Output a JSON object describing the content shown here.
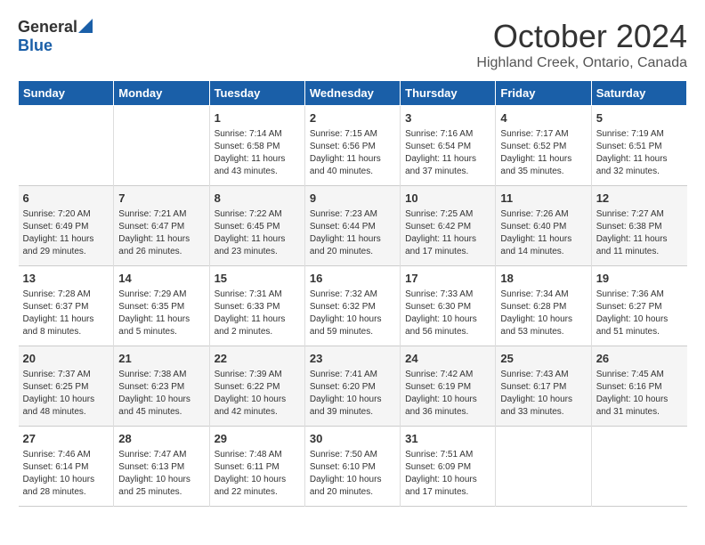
{
  "header": {
    "logo_general": "General",
    "logo_blue": "Blue",
    "month": "October 2024",
    "location": "Highland Creek, Ontario, Canada"
  },
  "calendar": {
    "weekdays": [
      "Sunday",
      "Monday",
      "Tuesday",
      "Wednesday",
      "Thursday",
      "Friday",
      "Saturday"
    ],
    "weeks": [
      [
        {
          "day": "",
          "info": ""
        },
        {
          "day": "",
          "info": ""
        },
        {
          "day": "1",
          "info": "Sunrise: 7:14 AM\nSunset: 6:58 PM\nDaylight: 11 hours and 43 minutes."
        },
        {
          "day": "2",
          "info": "Sunrise: 7:15 AM\nSunset: 6:56 PM\nDaylight: 11 hours and 40 minutes."
        },
        {
          "day": "3",
          "info": "Sunrise: 7:16 AM\nSunset: 6:54 PM\nDaylight: 11 hours and 37 minutes."
        },
        {
          "day": "4",
          "info": "Sunrise: 7:17 AM\nSunset: 6:52 PM\nDaylight: 11 hours and 35 minutes."
        },
        {
          "day": "5",
          "info": "Sunrise: 7:19 AM\nSunset: 6:51 PM\nDaylight: 11 hours and 32 minutes."
        }
      ],
      [
        {
          "day": "6",
          "info": "Sunrise: 7:20 AM\nSunset: 6:49 PM\nDaylight: 11 hours and 29 minutes."
        },
        {
          "day": "7",
          "info": "Sunrise: 7:21 AM\nSunset: 6:47 PM\nDaylight: 11 hours and 26 minutes."
        },
        {
          "day": "8",
          "info": "Sunrise: 7:22 AM\nSunset: 6:45 PM\nDaylight: 11 hours and 23 minutes."
        },
        {
          "day": "9",
          "info": "Sunrise: 7:23 AM\nSunset: 6:44 PM\nDaylight: 11 hours and 20 minutes."
        },
        {
          "day": "10",
          "info": "Sunrise: 7:25 AM\nSunset: 6:42 PM\nDaylight: 11 hours and 17 minutes."
        },
        {
          "day": "11",
          "info": "Sunrise: 7:26 AM\nSunset: 6:40 PM\nDaylight: 11 hours and 14 minutes."
        },
        {
          "day": "12",
          "info": "Sunrise: 7:27 AM\nSunset: 6:38 PM\nDaylight: 11 hours and 11 minutes."
        }
      ],
      [
        {
          "day": "13",
          "info": "Sunrise: 7:28 AM\nSunset: 6:37 PM\nDaylight: 11 hours and 8 minutes."
        },
        {
          "day": "14",
          "info": "Sunrise: 7:29 AM\nSunset: 6:35 PM\nDaylight: 11 hours and 5 minutes."
        },
        {
          "day": "15",
          "info": "Sunrise: 7:31 AM\nSunset: 6:33 PM\nDaylight: 11 hours and 2 minutes."
        },
        {
          "day": "16",
          "info": "Sunrise: 7:32 AM\nSunset: 6:32 PM\nDaylight: 10 hours and 59 minutes."
        },
        {
          "day": "17",
          "info": "Sunrise: 7:33 AM\nSunset: 6:30 PM\nDaylight: 10 hours and 56 minutes."
        },
        {
          "day": "18",
          "info": "Sunrise: 7:34 AM\nSunset: 6:28 PM\nDaylight: 10 hours and 53 minutes."
        },
        {
          "day": "19",
          "info": "Sunrise: 7:36 AM\nSunset: 6:27 PM\nDaylight: 10 hours and 51 minutes."
        }
      ],
      [
        {
          "day": "20",
          "info": "Sunrise: 7:37 AM\nSunset: 6:25 PM\nDaylight: 10 hours and 48 minutes."
        },
        {
          "day": "21",
          "info": "Sunrise: 7:38 AM\nSunset: 6:23 PM\nDaylight: 10 hours and 45 minutes."
        },
        {
          "day": "22",
          "info": "Sunrise: 7:39 AM\nSunset: 6:22 PM\nDaylight: 10 hours and 42 minutes."
        },
        {
          "day": "23",
          "info": "Sunrise: 7:41 AM\nSunset: 6:20 PM\nDaylight: 10 hours and 39 minutes."
        },
        {
          "day": "24",
          "info": "Sunrise: 7:42 AM\nSunset: 6:19 PM\nDaylight: 10 hours and 36 minutes."
        },
        {
          "day": "25",
          "info": "Sunrise: 7:43 AM\nSunset: 6:17 PM\nDaylight: 10 hours and 33 minutes."
        },
        {
          "day": "26",
          "info": "Sunrise: 7:45 AM\nSunset: 6:16 PM\nDaylight: 10 hours and 31 minutes."
        }
      ],
      [
        {
          "day": "27",
          "info": "Sunrise: 7:46 AM\nSunset: 6:14 PM\nDaylight: 10 hours and 28 minutes."
        },
        {
          "day": "28",
          "info": "Sunrise: 7:47 AM\nSunset: 6:13 PM\nDaylight: 10 hours and 25 minutes."
        },
        {
          "day": "29",
          "info": "Sunrise: 7:48 AM\nSunset: 6:11 PM\nDaylight: 10 hours and 22 minutes."
        },
        {
          "day": "30",
          "info": "Sunrise: 7:50 AM\nSunset: 6:10 PM\nDaylight: 10 hours and 20 minutes."
        },
        {
          "day": "31",
          "info": "Sunrise: 7:51 AM\nSunset: 6:09 PM\nDaylight: 10 hours and 17 minutes."
        },
        {
          "day": "",
          "info": ""
        },
        {
          "day": "",
          "info": ""
        }
      ]
    ]
  }
}
